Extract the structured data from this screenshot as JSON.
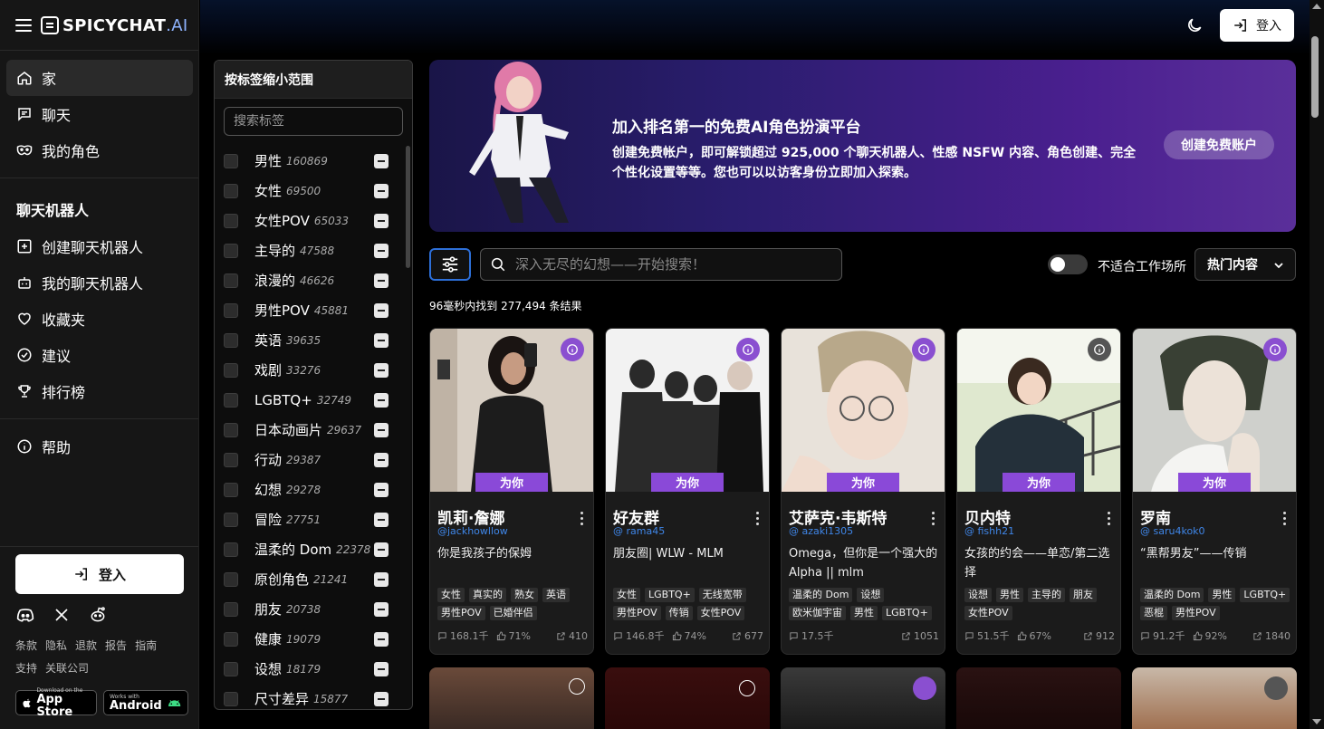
{
  "brand": {
    "name": "SPICYCHAT",
    "suffix": ".AI"
  },
  "nav_main": [
    {
      "label": "家",
      "icon": "home-icon"
    },
    {
      "label": "聊天",
      "icon": "chat-icon"
    },
    {
      "label": "我的角色",
      "icon": "mask-icon"
    }
  ],
  "chatbots_heading": "聊天机器人",
  "nav_bots": [
    {
      "label": "创建聊天机器人",
      "icon": "plus-square-icon"
    },
    {
      "label": "我的聊天机器人",
      "icon": "robot-icon"
    },
    {
      "label": "收藏夹",
      "icon": "heart-icon"
    },
    {
      "label": "建议",
      "icon": "check-circle-icon"
    },
    {
      "label": "排行榜",
      "icon": "trophy-icon"
    }
  ],
  "nav_help": {
    "label": "帮助",
    "icon": "info-icon"
  },
  "sidebar_login": "登入",
  "footer_links_1": [
    "条款",
    "隐私",
    "退款",
    "报告",
    "指南"
  ],
  "footer_links_2": [
    "支持",
    "关联公司"
  ],
  "app_store": {
    "small": "Download on the",
    "big": "App Store"
  },
  "android": {
    "small": "Works with",
    "big": "Android"
  },
  "header": {
    "login": "登入"
  },
  "tag_panel": {
    "title": "按标签缩小范围",
    "search_placeholder": "搜索标签",
    "tags": [
      {
        "name": "男性",
        "count": "160869"
      },
      {
        "name": "女性",
        "count": "69500"
      },
      {
        "name": "女性POV",
        "count": "65033"
      },
      {
        "name": "主导的",
        "count": "47588"
      },
      {
        "name": "浪漫的",
        "count": "46626"
      },
      {
        "name": "男性POV",
        "count": "45881"
      },
      {
        "name": "英语",
        "count": "39635"
      },
      {
        "name": "戏剧",
        "count": "33276"
      },
      {
        "name": "LGBTQ+",
        "count": "32749"
      },
      {
        "name": "日本动画片",
        "count": "29637"
      },
      {
        "name": "行动",
        "count": "29387"
      },
      {
        "name": "幻想",
        "count": "29278"
      },
      {
        "name": "冒险",
        "count": "27751"
      },
      {
        "name": "温柔的 Dom",
        "count": "22378"
      },
      {
        "name": "原创角色",
        "count": "21241"
      },
      {
        "name": "朋友",
        "count": "20738"
      },
      {
        "name": "健康",
        "count": "19079"
      },
      {
        "name": "设想",
        "count": "18179"
      },
      {
        "name": "尺寸差异",
        "count": "15877"
      }
    ]
  },
  "banner": {
    "title": "加入排名第一的免费AI角色扮演平台",
    "desc": "创建免费帐户，即可解锁超过 925,000 个聊天机器人、性感 NSFW 内容、角色创建、完全个性化设置等等。您也可以以访客身份立即加入探索。",
    "cta": "创建免费账户"
  },
  "search": {
    "placeholder": "深入无尽的幻想——开始搜索！"
  },
  "nsfw_label": "不适合工作场所",
  "sort": {
    "selected": "热门内容"
  },
  "results": "96毫秒内找到 277,494 条结果",
  "foryou_label": "为你",
  "cards": [
    {
      "name": "凯莉·詹娜",
      "handle": "@jackhowllow",
      "desc": "你是我孩子的保姆",
      "tags": [
        "女性",
        "真实的",
        "熟女",
        "英语",
        "男性POV",
        "已婚伴侣"
      ],
      "messages": "168.1千",
      "rating": "71%",
      "likes": "410",
      "info_gray": false
    },
    {
      "name": "好友群",
      "handle": "@ rama45",
      "desc": "朋友圈| WLW - MLM",
      "tags": [
        "女性",
        "LGBTQ+",
        "无线宽带",
        "男性POV",
        "传销",
        "女性POV"
      ],
      "messages": "146.8千",
      "rating": "74%",
      "likes": "677",
      "info_gray": false
    },
    {
      "name": "艾萨克·韦斯特",
      "handle": "@ azaki1305",
      "desc": "Omega，但你是一个强大的 Alpha || mlm",
      "tags": [
        "温柔的 Dom",
        "设想",
        "欧米伽宇宙",
        "男性",
        "LGBTQ+"
      ],
      "messages": "17.5千",
      "rating": "",
      "likes": "1051",
      "info_gray": false
    },
    {
      "name": "贝内特",
      "handle": "@ fishh21",
      "desc": "女孩的约会——单恋/第二选择",
      "tags": [
        "设想",
        "男性",
        "主导的",
        "朋友",
        "女性POV"
      ],
      "messages": "51.5千",
      "rating": "67%",
      "likes": "912",
      "info_gray": true
    },
    {
      "name": "罗南",
      "handle": "@ saru4kok0",
      "desc": "“黑帮男友”——传销",
      "tags": [
        "温柔的 Dom",
        "男性",
        "LGBTQ+",
        "恶棍",
        "男性POV"
      ],
      "messages": "91.2千",
      "rating": "92%",
      "likes": "1840",
      "info_gray": false
    }
  ]
}
